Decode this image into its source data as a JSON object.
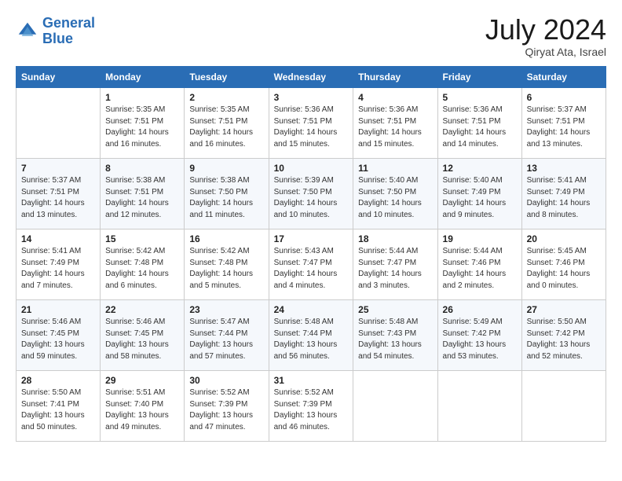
{
  "header": {
    "logo_line1": "General",
    "logo_line2": "Blue",
    "month_year": "July 2024",
    "location": "Qiryat Ata, Israel"
  },
  "columns": [
    "Sunday",
    "Monday",
    "Tuesday",
    "Wednesday",
    "Thursday",
    "Friday",
    "Saturday"
  ],
  "weeks": [
    [
      {
        "day": "",
        "sunrise": "",
        "sunset": "",
        "daylight": ""
      },
      {
        "day": "1",
        "sunrise": "Sunrise: 5:35 AM",
        "sunset": "Sunset: 7:51 PM",
        "daylight": "Daylight: 14 hours and 16 minutes."
      },
      {
        "day": "2",
        "sunrise": "Sunrise: 5:35 AM",
        "sunset": "Sunset: 7:51 PM",
        "daylight": "Daylight: 14 hours and 16 minutes."
      },
      {
        "day": "3",
        "sunrise": "Sunrise: 5:36 AM",
        "sunset": "Sunset: 7:51 PM",
        "daylight": "Daylight: 14 hours and 15 minutes."
      },
      {
        "day": "4",
        "sunrise": "Sunrise: 5:36 AM",
        "sunset": "Sunset: 7:51 PM",
        "daylight": "Daylight: 14 hours and 15 minutes."
      },
      {
        "day": "5",
        "sunrise": "Sunrise: 5:36 AM",
        "sunset": "Sunset: 7:51 PM",
        "daylight": "Daylight: 14 hours and 14 minutes."
      },
      {
        "day": "6",
        "sunrise": "Sunrise: 5:37 AM",
        "sunset": "Sunset: 7:51 PM",
        "daylight": "Daylight: 14 hours and 13 minutes."
      }
    ],
    [
      {
        "day": "7",
        "sunrise": "Sunrise: 5:37 AM",
        "sunset": "Sunset: 7:51 PM",
        "daylight": "Daylight: 14 hours and 13 minutes."
      },
      {
        "day": "8",
        "sunrise": "Sunrise: 5:38 AM",
        "sunset": "Sunset: 7:51 PM",
        "daylight": "Daylight: 14 hours and 12 minutes."
      },
      {
        "day": "9",
        "sunrise": "Sunrise: 5:38 AM",
        "sunset": "Sunset: 7:50 PM",
        "daylight": "Daylight: 14 hours and 11 minutes."
      },
      {
        "day": "10",
        "sunrise": "Sunrise: 5:39 AM",
        "sunset": "Sunset: 7:50 PM",
        "daylight": "Daylight: 14 hours and 10 minutes."
      },
      {
        "day": "11",
        "sunrise": "Sunrise: 5:40 AM",
        "sunset": "Sunset: 7:50 PM",
        "daylight": "Daylight: 14 hours and 10 minutes."
      },
      {
        "day": "12",
        "sunrise": "Sunrise: 5:40 AM",
        "sunset": "Sunset: 7:49 PM",
        "daylight": "Daylight: 14 hours and 9 minutes."
      },
      {
        "day": "13",
        "sunrise": "Sunrise: 5:41 AM",
        "sunset": "Sunset: 7:49 PM",
        "daylight": "Daylight: 14 hours and 8 minutes."
      }
    ],
    [
      {
        "day": "14",
        "sunrise": "Sunrise: 5:41 AM",
        "sunset": "Sunset: 7:49 PM",
        "daylight": "Daylight: 14 hours and 7 minutes."
      },
      {
        "day": "15",
        "sunrise": "Sunrise: 5:42 AM",
        "sunset": "Sunset: 7:48 PM",
        "daylight": "Daylight: 14 hours and 6 minutes."
      },
      {
        "day": "16",
        "sunrise": "Sunrise: 5:42 AM",
        "sunset": "Sunset: 7:48 PM",
        "daylight": "Daylight: 14 hours and 5 minutes."
      },
      {
        "day": "17",
        "sunrise": "Sunrise: 5:43 AM",
        "sunset": "Sunset: 7:47 PM",
        "daylight": "Daylight: 14 hours and 4 minutes."
      },
      {
        "day": "18",
        "sunrise": "Sunrise: 5:44 AM",
        "sunset": "Sunset: 7:47 PM",
        "daylight": "Daylight: 14 hours and 3 minutes."
      },
      {
        "day": "19",
        "sunrise": "Sunrise: 5:44 AM",
        "sunset": "Sunset: 7:46 PM",
        "daylight": "Daylight: 14 hours and 2 minutes."
      },
      {
        "day": "20",
        "sunrise": "Sunrise: 5:45 AM",
        "sunset": "Sunset: 7:46 PM",
        "daylight": "Daylight: 14 hours and 0 minutes."
      }
    ],
    [
      {
        "day": "21",
        "sunrise": "Sunrise: 5:46 AM",
        "sunset": "Sunset: 7:45 PM",
        "daylight": "Daylight: 13 hours and 59 minutes."
      },
      {
        "day": "22",
        "sunrise": "Sunrise: 5:46 AM",
        "sunset": "Sunset: 7:45 PM",
        "daylight": "Daylight: 13 hours and 58 minutes."
      },
      {
        "day": "23",
        "sunrise": "Sunrise: 5:47 AM",
        "sunset": "Sunset: 7:44 PM",
        "daylight": "Daylight: 13 hours and 57 minutes."
      },
      {
        "day": "24",
        "sunrise": "Sunrise: 5:48 AM",
        "sunset": "Sunset: 7:44 PM",
        "daylight": "Daylight: 13 hours and 56 minutes."
      },
      {
        "day": "25",
        "sunrise": "Sunrise: 5:48 AM",
        "sunset": "Sunset: 7:43 PM",
        "daylight": "Daylight: 13 hours and 54 minutes."
      },
      {
        "day": "26",
        "sunrise": "Sunrise: 5:49 AM",
        "sunset": "Sunset: 7:42 PM",
        "daylight": "Daylight: 13 hours and 53 minutes."
      },
      {
        "day": "27",
        "sunrise": "Sunrise: 5:50 AM",
        "sunset": "Sunset: 7:42 PM",
        "daylight": "Daylight: 13 hours and 52 minutes."
      }
    ],
    [
      {
        "day": "28",
        "sunrise": "Sunrise: 5:50 AM",
        "sunset": "Sunset: 7:41 PM",
        "daylight": "Daylight: 13 hours and 50 minutes."
      },
      {
        "day": "29",
        "sunrise": "Sunrise: 5:51 AM",
        "sunset": "Sunset: 7:40 PM",
        "daylight": "Daylight: 13 hours and 49 minutes."
      },
      {
        "day": "30",
        "sunrise": "Sunrise: 5:52 AM",
        "sunset": "Sunset: 7:39 PM",
        "daylight": "Daylight: 13 hours and 47 minutes."
      },
      {
        "day": "31",
        "sunrise": "Sunrise: 5:52 AM",
        "sunset": "Sunset: 7:39 PM",
        "daylight": "Daylight: 13 hours and 46 minutes."
      },
      {
        "day": "",
        "sunrise": "",
        "sunset": "",
        "daylight": ""
      },
      {
        "day": "",
        "sunrise": "",
        "sunset": "",
        "daylight": ""
      },
      {
        "day": "",
        "sunrise": "",
        "sunset": "",
        "daylight": ""
      }
    ]
  ]
}
